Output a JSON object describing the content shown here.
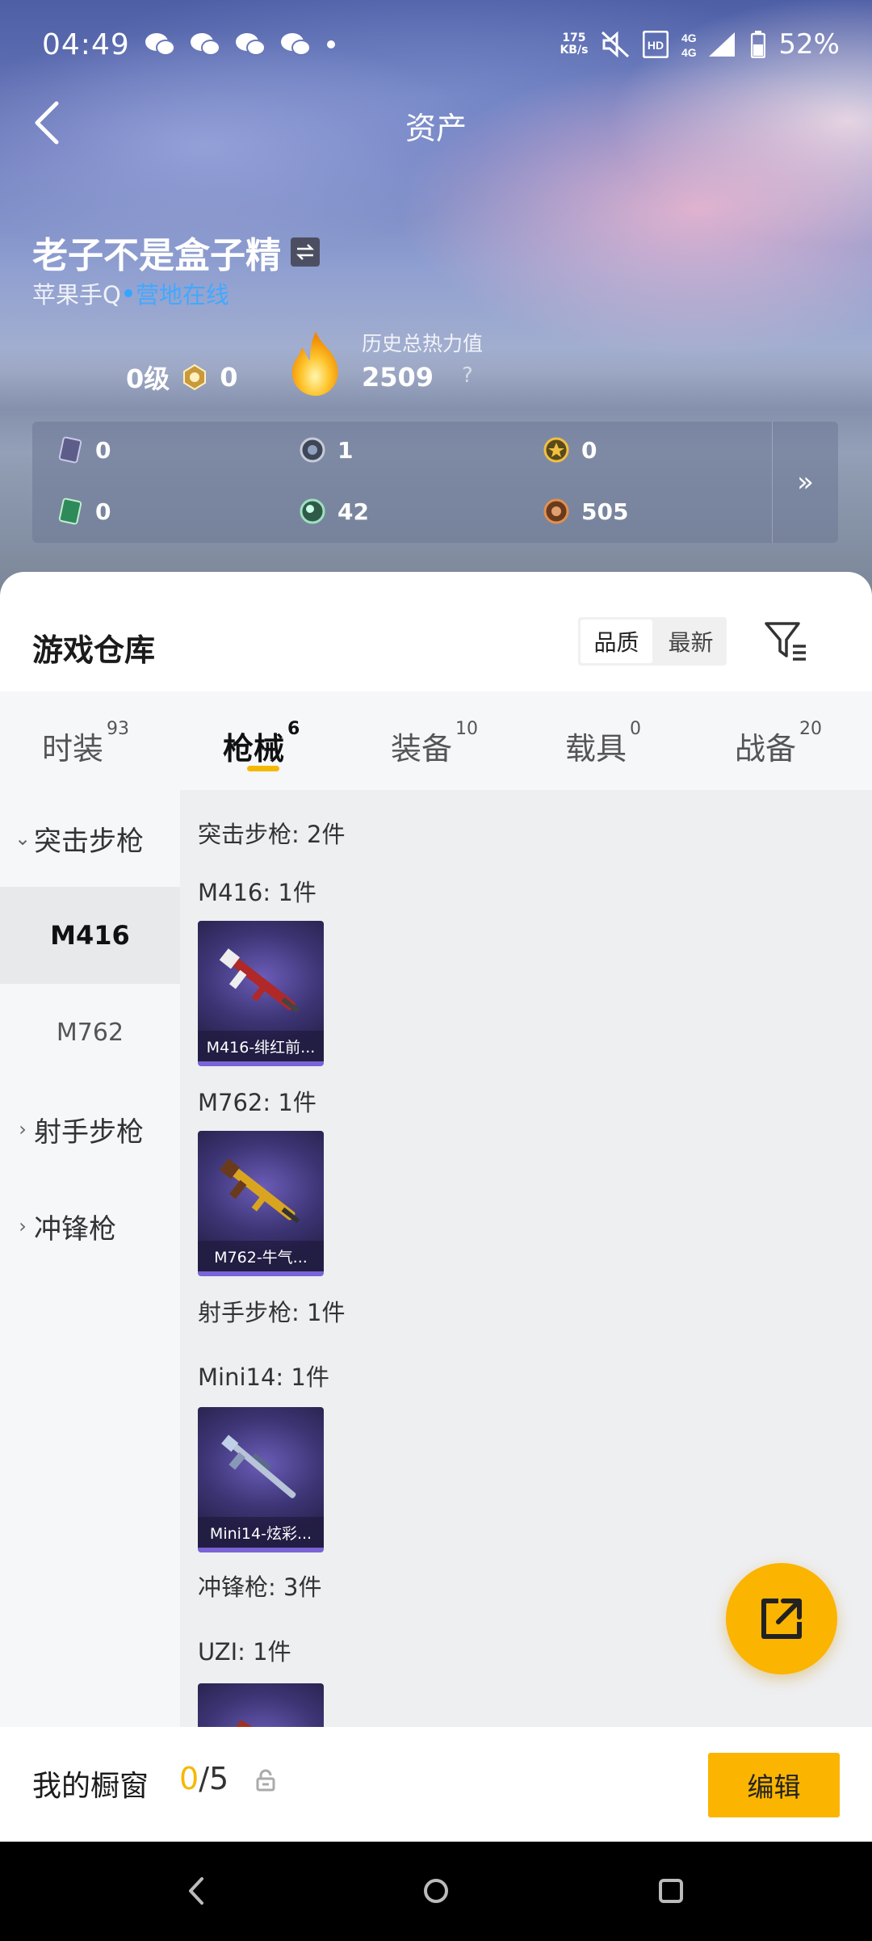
{
  "status_bar": {
    "time": "04:49",
    "speed_value": "175",
    "speed_unit": "KB/s",
    "battery": "52%"
  },
  "header": {
    "title": "资产"
  },
  "profile": {
    "name": "老子不是盒子精",
    "platform": "苹果手Q",
    "online_status": "营地在线",
    "level": "0级",
    "badge_count": "0",
    "heat_label": "历史总热力值",
    "heat_value": "2509",
    "heat_help": "?"
  },
  "stats": [
    {
      "icon": "card-icon",
      "value": "0"
    },
    {
      "icon": "silver-coin-icon",
      "value": "1"
    },
    {
      "icon": "gold-coin-icon",
      "value": "0"
    },
    {
      "icon": "green-card-icon",
      "value": "0"
    },
    {
      "icon": "green-orb-icon",
      "value": "42"
    },
    {
      "icon": "bronze-coin-icon",
      "value": "505"
    }
  ],
  "stats_more": "»",
  "warehouse": {
    "title": "游戏仓库",
    "sort_options": [
      "品质",
      "最新"
    ],
    "sort_active": "品质"
  },
  "tabs": [
    {
      "label": "时装",
      "count": "93"
    },
    {
      "label": "枪械",
      "count": "6",
      "active": true
    },
    {
      "label": "装备",
      "count": "10"
    },
    {
      "label": "载具",
      "count": "0"
    },
    {
      "label": "战备",
      "count": "20"
    }
  ],
  "categories": {
    "assault": "突击步枪",
    "m416": "M416",
    "m762": "M762",
    "marksman": "射手步枪",
    "smg": "冲锋枪"
  },
  "content": {
    "assault_header": "突击步枪: 2件",
    "m416_header": "M416: 1件",
    "m416_item": "M416-绯红前...",
    "m762_header": "M762: 1件",
    "m762_item": "M762-牛气...",
    "marksman_header": "射手步枪: 1件",
    "mini14_header": "Mini14: 1件",
    "mini14_item": "Mini14-炫彩...",
    "smg_header": "冲锋枪: 3件",
    "uzi_header": "UZI: 1件"
  },
  "showcase": {
    "label": "我的橱窗",
    "current": "0",
    "total": "/5",
    "edit_label": "编辑"
  },
  "colors": {
    "accent": "#fbb400",
    "online": "#43a8ff",
    "card_purple": "#3d3575"
  }
}
